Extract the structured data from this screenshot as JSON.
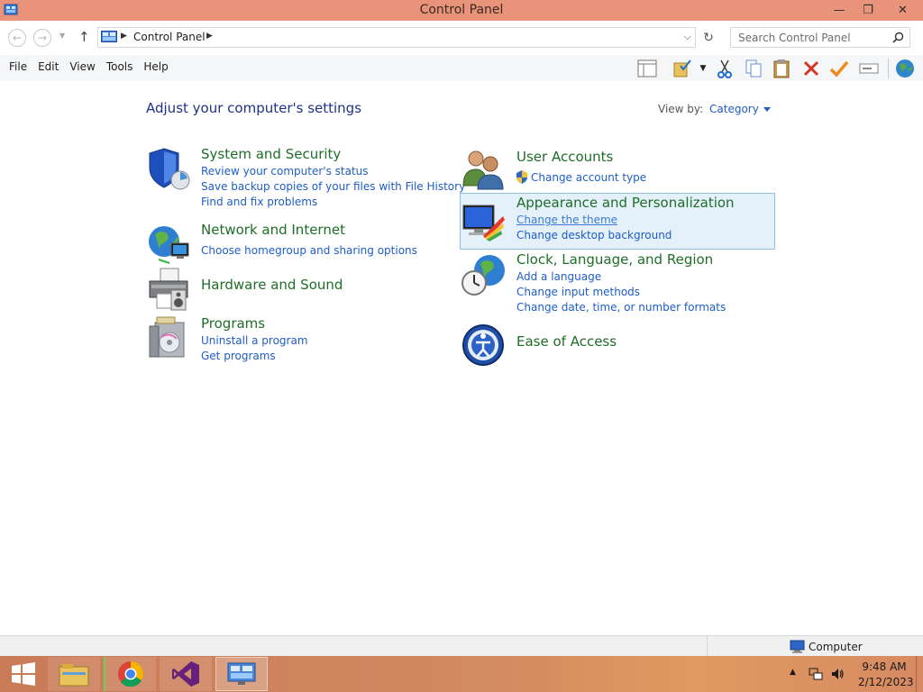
{
  "window": {
    "title": "Control Panel",
    "controls": {
      "minimize": "—",
      "maximize": "❐",
      "close": "✕"
    }
  },
  "address": {
    "crumb": "Control Panel",
    "search_placeholder": "Search Control Panel"
  },
  "menu": [
    "File",
    "Edit",
    "View",
    "Tools",
    "Help"
  ],
  "toolbar_icons": [
    "layout-icon",
    "folder-checkmark-icon",
    "dropdown-arrow-icon",
    "cut-icon",
    "copy-icon",
    "paste-icon",
    "delete-icon",
    "check-icon",
    "rename-icon",
    "globe-icon"
  ],
  "main": {
    "heading": "Adjust your computer's settings",
    "view_by_label": "View by:",
    "view_by_value": "Category"
  },
  "categories": {
    "system_security": {
      "title": "System and Security",
      "links": [
        "Review your computer's status",
        "Save backup copies of your files with File History",
        "Find and fix problems"
      ]
    },
    "network": {
      "title": "Network and Internet",
      "links": [
        "Choose homegroup and sharing options"
      ]
    },
    "hardware": {
      "title": "Hardware and Sound",
      "links": []
    },
    "programs": {
      "title": "Programs",
      "links": [
        "Uninstall a program",
        "Get programs"
      ]
    },
    "user_accounts": {
      "title": "User Accounts",
      "links": [
        "Change account type"
      ]
    },
    "appearance": {
      "title": "Appearance and Personalization",
      "links": [
        "Change the theme",
        "Change desktop background"
      ]
    },
    "clock": {
      "title": "Clock, Language, and Region",
      "links": [
        "Add a language",
        "Change input methods",
        "Change date, time, or number formats"
      ]
    },
    "ease": {
      "title": "Ease of Access",
      "links": []
    }
  },
  "statusbar": {
    "location": "Computer"
  },
  "taskbar": {
    "apps": [
      "windows-start-icon",
      "file-explorer-icon",
      "chrome-icon",
      "visual-studio-icon",
      "control-panel-icon"
    ],
    "time": "9:48 AM",
    "date": "2/12/2023"
  },
  "colors": {
    "titlebar": "#e8937a",
    "category_title": "#1e6e28",
    "link": "#1e5dc8",
    "heading": "#1e3287",
    "hover_bg": "#e4f1fa"
  }
}
